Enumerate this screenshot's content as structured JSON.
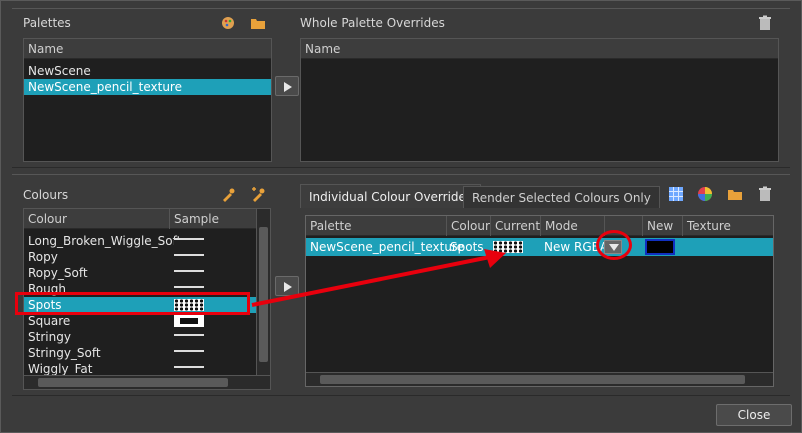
{
  "palettes": {
    "title": "Palettes",
    "column_name": "Name",
    "items": [
      "NewScene",
      "NewScene_pencil_texture"
    ],
    "selected_index": 1
  },
  "whole_overrides": {
    "title": "Whole Palette Overrides",
    "column_name": "Name"
  },
  "colours": {
    "title": "Colours",
    "column_colour": "Colour",
    "column_sample": "Sample",
    "items": [
      {
        "name": "Long_Broken_Wiggle_Soft",
        "sample": "line"
      },
      {
        "name": "Ropy",
        "sample": "line"
      },
      {
        "name": "Ropy_Soft",
        "sample": "line"
      },
      {
        "name": "Rough",
        "sample": "line"
      },
      {
        "name": "Spots",
        "sample": "dots"
      },
      {
        "name": "Square",
        "sample": "black"
      },
      {
        "name": "Stringy",
        "sample": "line"
      },
      {
        "name": "Stringy_Soft",
        "sample": "line"
      },
      {
        "name": "Wiggly_Fat",
        "sample": "line"
      }
    ],
    "selected_index": 4
  },
  "overrides": {
    "tab_individual": "Individual Colour Overrides",
    "tab_render": "Render Selected Colours Only",
    "columns": [
      "Palette",
      "Colour",
      "Current",
      "Mode",
      "",
      "New",
      "Texture Filename"
    ],
    "row": {
      "palette": "NewScene_pencil_texture",
      "colour": "Spots",
      "mode": "New RGBA"
    }
  },
  "footer": {
    "close_label": "Close"
  },
  "colors": {
    "accent": "#1ea0b8",
    "annotation": "#e8000d"
  }
}
